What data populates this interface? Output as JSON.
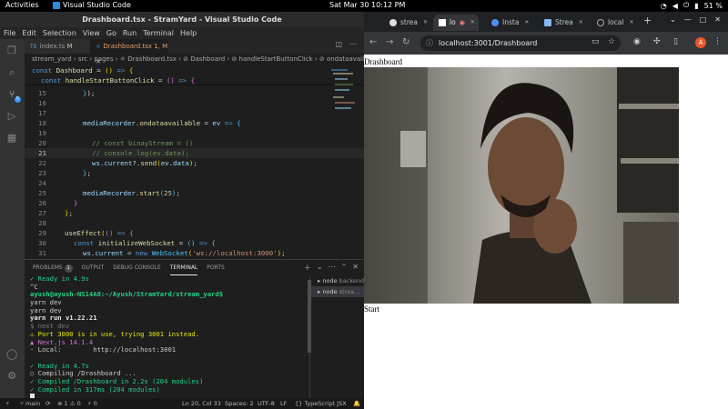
{
  "topbar": {
    "activities": "Activities",
    "app_name": "Visual Studio Code",
    "clock": "Sat Mar 30  10:12 PM",
    "battery": "51 %"
  },
  "vscode": {
    "title": "Drashboard.tsx - StramYard - Visual Studio Code",
    "menu": [
      "File",
      "Edit",
      "Selection",
      "View",
      "Go",
      "Run",
      "Terminal",
      "Help"
    ],
    "scm_badge": "5",
    "tabs": [
      {
        "label": "index.ts",
        "badge": "M",
        "active": false
      },
      {
        "label": "Drashboard.tsx",
        "badge": "1, M",
        "active": true
      }
    ],
    "breadcrumbs": "stream_yard › src › pages › ⚛ Drashboard.tsx › ⊘ Dashboard › ⊘ handleStartButtonClick › ⊘ ondataavailab",
    "sticky_lines": [
      "const Dashboard = () => {",
      "  const handleStartButtonClick = () => {"
    ],
    "line_numbers": [
      "15",
      "16",
      "17",
      "18",
      "19",
      "20",
      "21",
      "22",
      "23",
      "24",
      "25",
      "26",
      "27",
      "28",
      "29",
      "30",
      "31"
    ],
    "current_line": "20",
    "panel_tabs": [
      "PROBLEMS",
      "OUTPUT",
      "DEBUG CONSOLE",
      "TERMINAL",
      "PORTS"
    ],
    "problems_count": "1",
    "terminal_lines": [
      "✓ Ready in 4.9s",
      "^C",
      "ayush@ayush-NS14A8:~/Ayush/StramYard/stream_yard$",
      "yarn dev",
      "yarn dev",
      "yarn run v1.22.21",
      "$ next dev",
      "⚠ Port 3000 is in use, trying 3001 instead.",
      "▲ Next.js 14.1.4",
      "- Local:        http://localhost:3001",
      "",
      "✓ Ready in 4.7s",
      "○ Compiling /Drashboard ...",
      "✓ Compiled /Drashboard in 2.2s (204 modules)",
      "✓ Compiled in 317ms (204 modules)"
    ],
    "terminals": [
      {
        "name": "node",
        "label": "backend"
      },
      {
        "name": "node",
        "label": "strea..."
      }
    ],
    "status": {
      "branch": "main",
      "sync": "⟳",
      "errors": "⊗ 1 ⚠ 0",
      "ports": "⚡ 0",
      "position": "Ln 20, Col 33",
      "spaces": "Spaces: 2",
      "encoding": "UTF-8",
      "eol": "LF",
      "language": "{} TypeScript JSX"
    }
  },
  "chrome": {
    "tabs": [
      {
        "label": "strea",
        "favicon": "github-icon",
        "active": false
      },
      {
        "label": "lo",
        "favicon": "vercel-icon",
        "active": true
      },
      {
        "label": "Insta",
        "favicon": "stream-icon",
        "active": false
      },
      {
        "label": "Strea",
        "favicon": "page-icon",
        "active": false
      },
      {
        "label": "local",
        "favicon": "globe-icon",
        "active": false
      }
    ],
    "url": "localhost:3001/Drashboard",
    "avatar_letter": "A",
    "page_heading": "Drashboard",
    "start_button": "Start"
  },
  "colors": {
    "vscode_bg": "#1e1e1e",
    "activitybar": "#333333",
    "chrome_frame": "#35363a",
    "accent": "#3794ff",
    "avatar": "#e8572b"
  }
}
